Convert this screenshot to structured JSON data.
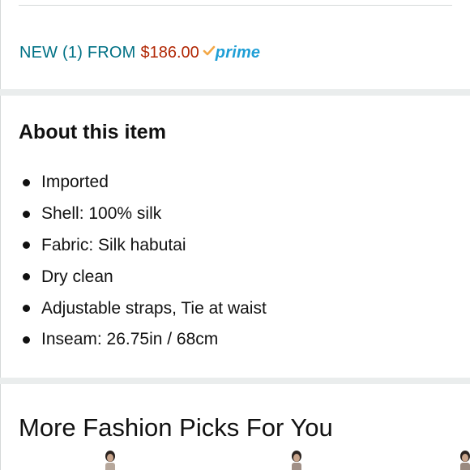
{
  "offer": {
    "label": "NEW (1) FROM",
    "price": "$186.00",
    "prime_text": "prime",
    "prime_icon": "check-icon",
    "colors": {
      "link": "#007185",
      "price": "#b12704",
      "prime": "#1f9fd6",
      "check": "#f3a847"
    }
  },
  "about": {
    "title": "About this item",
    "bullets": [
      "Imported",
      "Shell: 100% silk",
      "Fabric: Silk habutai",
      "Dry clean",
      "Adjustable straps, Tie at waist",
      "Inseam: 26.75in / 68cm"
    ]
  },
  "more": {
    "title": "More Fashion Picks For You"
  }
}
